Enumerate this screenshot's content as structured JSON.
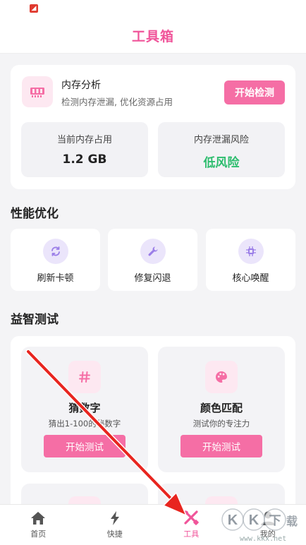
{
  "header": {
    "title": "工具箱"
  },
  "memory": {
    "title": "内存分析",
    "subtitle": "检测内存泄漏, 优化资源占用",
    "button": "开始检测",
    "usage_label": "当前内存占用",
    "usage_value": "1.2 GB",
    "risk_label": "内存泄漏风险",
    "risk_value": "低风险",
    "risk_color": "#2dbd6e"
  },
  "performance": {
    "title": "性能优化",
    "items": [
      {
        "label": "刷新卡顿",
        "icon": "refresh-icon"
      },
      {
        "label": "修复闪退",
        "icon": "wrench-icon"
      },
      {
        "label": "核心唤醒",
        "icon": "chip-icon"
      }
    ]
  },
  "games": {
    "title": "益智测试",
    "items": [
      {
        "name": "猜数字",
        "desc": "猜出1-100的秘数字",
        "button": "开始测试",
        "icon": "hash-icon"
      },
      {
        "name": "颜色匹配",
        "desc": "测试你的专注力",
        "button": "开始测试",
        "icon": "palette-icon"
      }
    ]
  },
  "tabs": [
    {
      "label": "首页",
      "icon": "home-icon"
    },
    {
      "label": "快捷",
      "icon": "lightning-icon"
    },
    {
      "label": "工具",
      "icon": "tools-icon",
      "active": true
    },
    {
      "label": "我的",
      "icon": "person-icon"
    }
  ],
  "watermark": {
    "text": "www.kkx.net"
  },
  "colors": {
    "accent": "#f56ea5",
    "title_pink": "#f0559a",
    "arrow": "#e8251f"
  }
}
